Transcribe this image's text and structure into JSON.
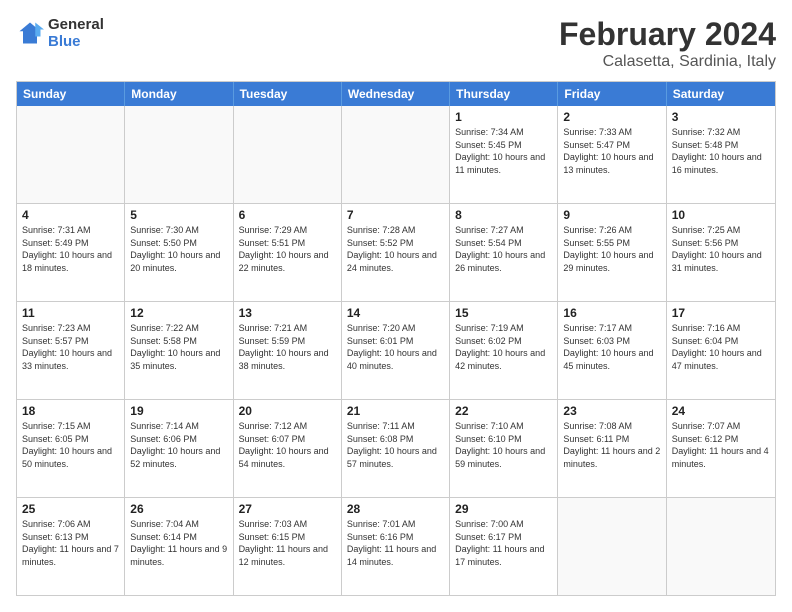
{
  "logo": {
    "text_general": "General",
    "text_blue": "Blue"
  },
  "header": {
    "title": "February 2024",
    "subtitle": "Calasetta, Sardinia, Italy"
  },
  "days_of_week": [
    "Sunday",
    "Monday",
    "Tuesday",
    "Wednesday",
    "Thursday",
    "Friday",
    "Saturday"
  ],
  "weeks": [
    [
      {
        "day": "",
        "empty": true
      },
      {
        "day": "",
        "empty": true
      },
      {
        "day": "",
        "empty": true
      },
      {
        "day": "",
        "empty": true
      },
      {
        "day": "1",
        "sunrise": "7:34 AM",
        "sunset": "5:45 PM",
        "daylight": "10 hours and 11 minutes."
      },
      {
        "day": "2",
        "sunrise": "7:33 AM",
        "sunset": "5:47 PM",
        "daylight": "10 hours and 13 minutes."
      },
      {
        "day": "3",
        "sunrise": "7:32 AM",
        "sunset": "5:48 PM",
        "daylight": "10 hours and 16 minutes."
      }
    ],
    [
      {
        "day": "4",
        "sunrise": "7:31 AM",
        "sunset": "5:49 PM",
        "daylight": "10 hours and 18 minutes."
      },
      {
        "day": "5",
        "sunrise": "7:30 AM",
        "sunset": "5:50 PM",
        "daylight": "10 hours and 20 minutes."
      },
      {
        "day": "6",
        "sunrise": "7:29 AM",
        "sunset": "5:51 PM",
        "daylight": "10 hours and 22 minutes."
      },
      {
        "day": "7",
        "sunrise": "7:28 AM",
        "sunset": "5:52 PM",
        "daylight": "10 hours and 24 minutes."
      },
      {
        "day": "8",
        "sunrise": "7:27 AM",
        "sunset": "5:54 PM",
        "daylight": "10 hours and 26 minutes."
      },
      {
        "day": "9",
        "sunrise": "7:26 AM",
        "sunset": "5:55 PM",
        "daylight": "10 hours and 29 minutes."
      },
      {
        "day": "10",
        "sunrise": "7:25 AM",
        "sunset": "5:56 PM",
        "daylight": "10 hours and 31 minutes."
      }
    ],
    [
      {
        "day": "11",
        "sunrise": "7:23 AM",
        "sunset": "5:57 PM",
        "daylight": "10 hours and 33 minutes."
      },
      {
        "day": "12",
        "sunrise": "7:22 AM",
        "sunset": "5:58 PM",
        "daylight": "10 hours and 35 minutes."
      },
      {
        "day": "13",
        "sunrise": "7:21 AM",
        "sunset": "5:59 PM",
        "daylight": "10 hours and 38 minutes."
      },
      {
        "day": "14",
        "sunrise": "7:20 AM",
        "sunset": "6:01 PM",
        "daylight": "10 hours and 40 minutes."
      },
      {
        "day": "15",
        "sunrise": "7:19 AM",
        "sunset": "6:02 PM",
        "daylight": "10 hours and 42 minutes."
      },
      {
        "day": "16",
        "sunrise": "7:17 AM",
        "sunset": "6:03 PM",
        "daylight": "10 hours and 45 minutes."
      },
      {
        "day": "17",
        "sunrise": "7:16 AM",
        "sunset": "6:04 PM",
        "daylight": "10 hours and 47 minutes."
      }
    ],
    [
      {
        "day": "18",
        "sunrise": "7:15 AM",
        "sunset": "6:05 PM",
        "daylight": "10 hours and 50 minutes."
      },
      {
        "day": "19",
        "sunrise": "7:14 AM",
        "sunset": "6:06 PM",
        "daylight": "10 hours and 52 minutes."
      },
      {
        "day": "20",
        "sunrise": "7:12 AM",
        "sunset": "6:07 PM",
        "daylight": "10 hours and 54 minutes."
      },
      {
        "day": "21",
        "sunrise": "7:11 AM",
        "sunset": "6:08 PM",
        "daylight": "10 hours and 57 minutes."
      },
      {
        "day": "22",
        "sunrise": "7:10 AM",
        "sunset": "6:10 PM",
        "daylight": "10 hours and 59 minutes."
      },
      {
        "day": "23",
        "sunrise": "7:08 AM",
        "sunset": "6:11 PM",
        "daylight": "11 hours and 2 minutes."
      },
      {
        "day": "24",
        "sunrise": "7:07 AM",
        "sunset": "6:12 PM",
        "daylight": "11 hours and 4 minutes."
      }
    ],
    [
      {
        "day": "25",
        "sunrise": "7:06 AM",
        "sunset": "6:13 PM",
        "daylight": "11 hours and 7 minutes."
      },
      {
        "day": "26",
        "sunrise": "7:04 AM",
        "sunset": "6:14 PM",
        "daylight": "11 hours and 9 minutes."
      },
      {
        "day": "27",
        "sunrise": "7:03 AM",
        "sunset": "6:15 PM",
        "daylight": "11 hours and 12 minutes."
      },
      {
        "day": "28",
        "sunrise": "7:01 AM",
        "sunset": "6:16 PM",
        "daylight": "11 hours and 14 minutes."
      },
      {
        "day": "29",
        "sunrise": "7:00 AM",
        "sunset": "6:17 PM",
        "daylight": "11 hours and 17 minutes."
      },
      {
        "day": "",
        "empty": true
      },
      {
        "day": "",
        "empty": true
      }
    ]
  ],
  "labels": {
    "sunrise_prefix": "Sunrise: ",
    "sunset_prefix": "Sunset: ",
    "daylight_prefix": "Daylight: "
  }
}
